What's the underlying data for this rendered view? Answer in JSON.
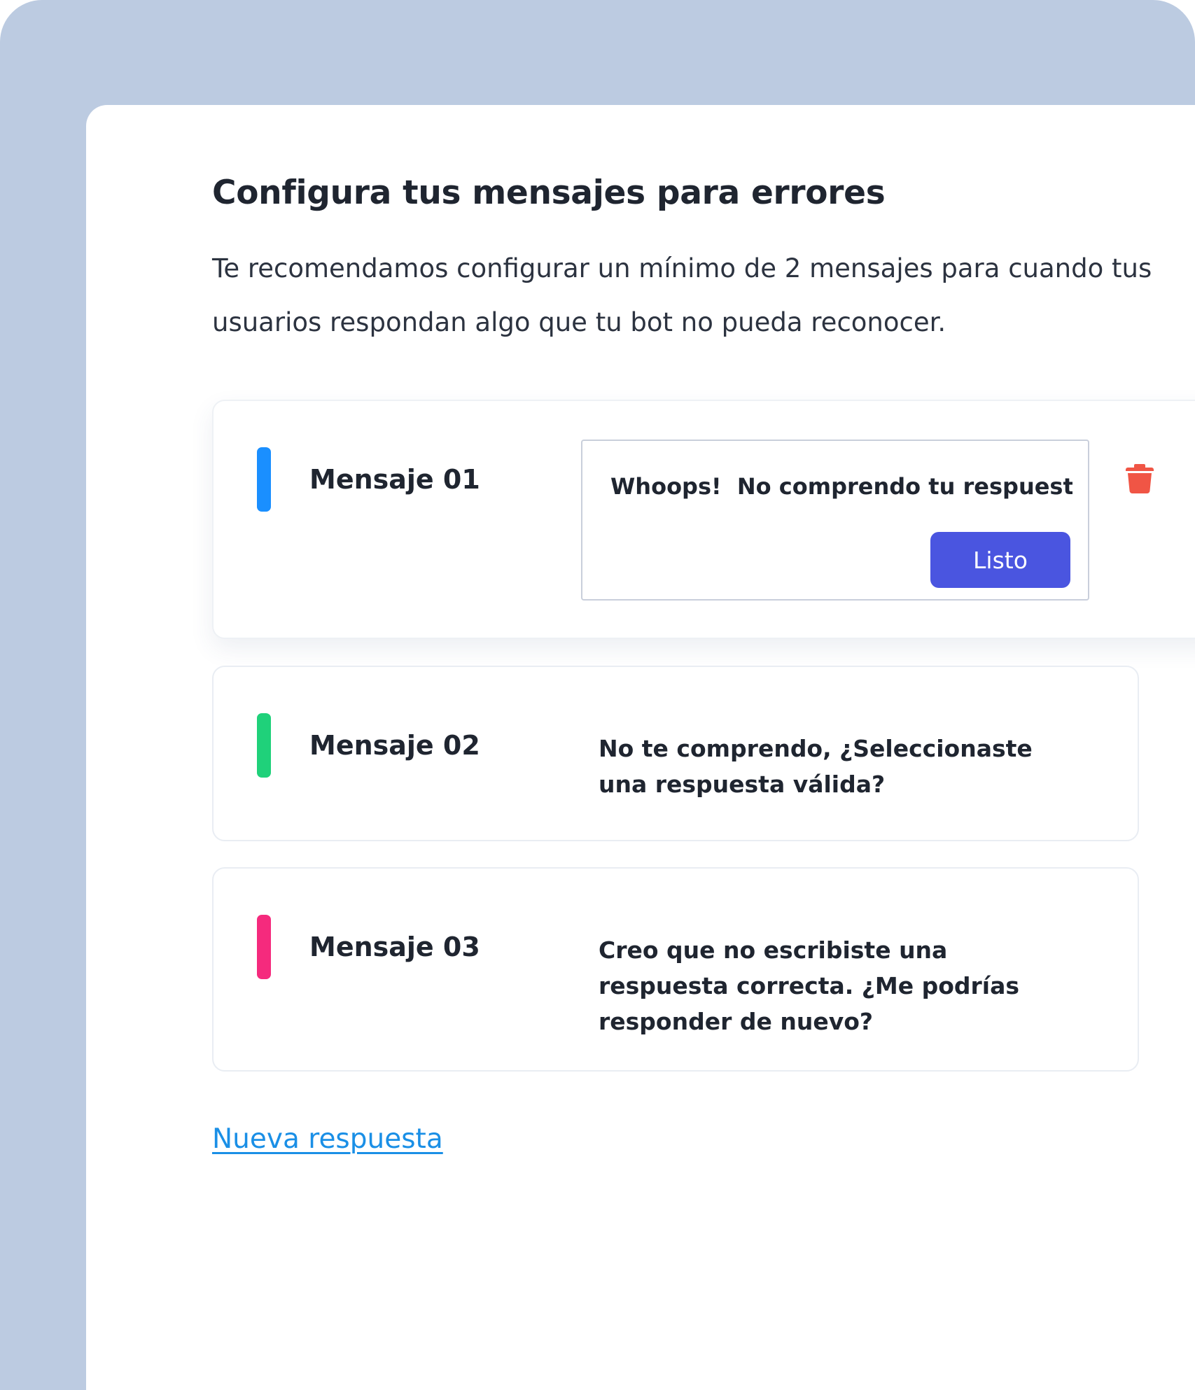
{
  "header": {
    "title": "Configura tus mensajes para errores",
    "description": "Te recomendamos configurar un mínimo de 2 mensajes para cuando tus usuarios respondan algo que tu bot no pueda reconocer."
  },
  "messages": [
    {
      "label": "Mensaje 01",
      "text": "Whoops!  No comprendo tu respuesta",
      "accent_color": "#1a8fff",
      "editing": true,
      "done_label": "Listo",
      "delete_icon": "trash-icon"
    },
    {
      "label": "Mensaje 02",
      "text": "No te comprendo, ¿Seleccionaste una respuesta válida?",
      "accent_color": "#1fd17a",
      "editing": false
    },
    {
      "label": "Mensaje 03",
      "text": "Creo que no escribiste una respuesta correcta. ¿Me podrías responder de nuevo?",
      "accent_color": "#f52a7d",
      "editing": false
    }
  ],
  "actions": {
    "new_response_label": "Nueva respuesta"
  },
  "colors": {
    "background": "#bccbe1",
    "primary_button": "#4a55e0",
    "link": "#1a8fe6",
    "delete": "#f05545"
  }
}
